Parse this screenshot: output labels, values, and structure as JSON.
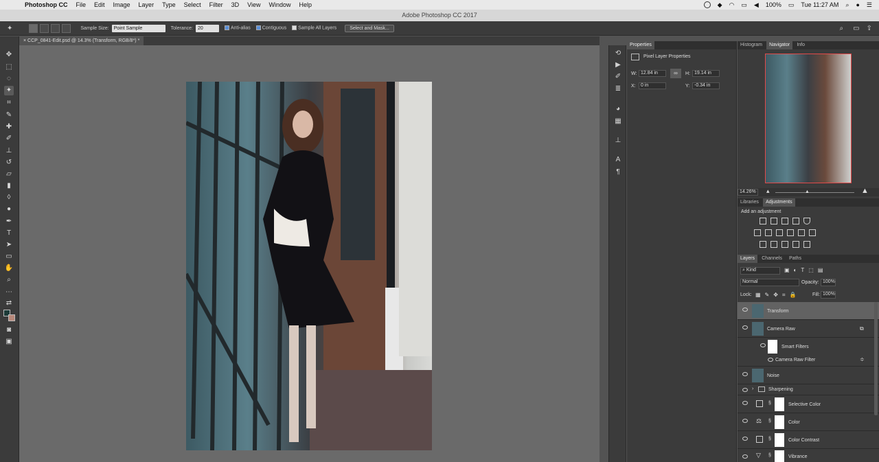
{
  "menubar": {
    "app_name": "Photoshop CC",
    "items": [
      "File",
      "Edit",
      "Image",
      "Layer",
      "Type",
      "Select",
      "Filter",
      "3D",
      "View",
      "Window",
      "Help"
    ],
    "battery": "100%",
    "clock": "Tue 11:27 AM"
  },
  "window_title": "Adobe Photoshop CC 2017",
  "options": {
    "sample_size_label": "Sample Size:",
    "sample_size_value": "Point Sample",
    "tolerance_label": "Tolerance:",
    "tolerance_value": "20",
    "anti_alias_label": "Anti-alias",
    "contiguous_label": "Contiguous",
    "sample_all_layers_label": "Sample All Layers",
    "select_mask_label": "Select and Mask..."
  },
  "document_tab": "CCP_0841-Edit.psd @ 14.3% (Transform, RGB/8*) *",
  "properties": {
    "tab_label": "Properties",
    "title": "Pixel Layer Properties",
    "w_label": "W:",
    "w_value": "12.84 in",
    "h_label": "H:",
    "h_value": "19.14 in",
    "x_label": "X:",
    "x_value": "0 in",
    "y_label": "Y:",
    "y_value": "-0.34 in"
  },
  "navigator": {
    "tabs": [
      "Histogram",
      "Navigator",
      "Info"
    ],
    "zoom": "14.26%"
  },
  "adjustments": {
    "tabs": [
      "Libraries",
      "Adjustments"
    ],
    "heading": "Add an adjustment"
  },
  "layers": {
    "tabs": [
      "Layers",
      "Channels",
      "Paths"
    ],
    "kind": "Kind",
    "blend_mode": "Normal",
    "opacity_label": "Opacity:",
    "opacity_value": "100%",
    "lock_label": "Lock:",
    "fill_label": "Fill:",
    "fill_value": "100%",
    "items": [
      {
        "name": "Transform"
      },
      {
        "name": "Camera Raw"
      },
      {
        "name": "Smart Filters"
      },
      {
        "name": "Camera Raw Filter"
      },
      {
        "name": "Noise"
      },
      {
        "name": "Sharpening"
      },
      {
        "name": "Selective Color"
      },
      {
        "name": "Color"
      },
      {
        "name": "Color Contrast"
      },
      {
        "name": "Vibrance"
      }
    ]
  }
}
